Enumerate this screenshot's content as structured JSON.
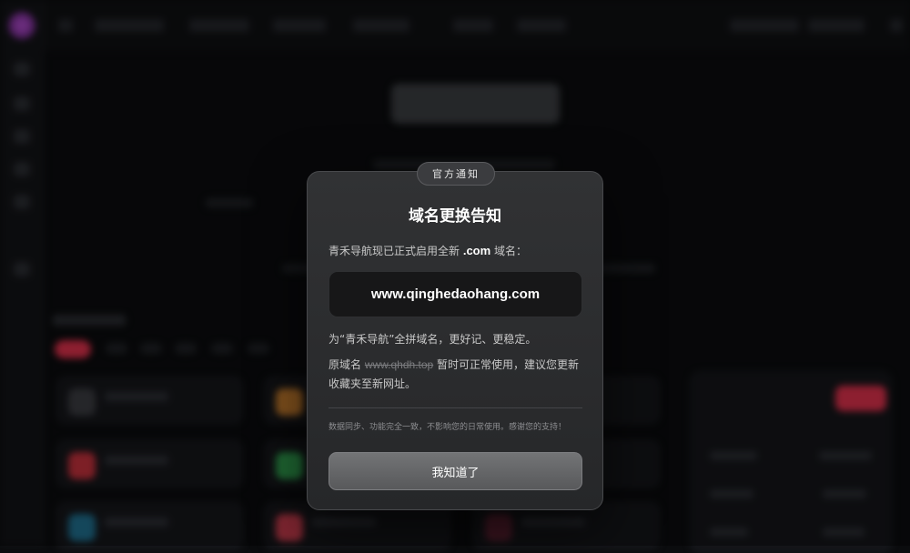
{
  "notice": {
    "badge": "官方通知",
    "title": "域名更换告知",
    "intro_before": "青禾导航现已正式启用全新 ",
    "intro_tld": ".com",
    "intro_after": " 域名：",
    "new_domain": "www.qinghedaohang.com",
    "reason": "为“青禾导航”全拼域名，更好记、更稳定。",
    "old_prefix": "原域名 ",
    "old_domain": "www.qhdh.top",
    "old_suffix": " 暂时可正常使用，建议您更新收藏夹至新网址。",
    "footnote": "数据同步、功能完全一致，不影响您的日常使用。感谢您的支持！",
    "confirm_label": "我知道了"
  },
  "colors": {
    "accent_red": "#d9304a",
    "logo_purple": "#b84fd6",
    "modal_bg": "#2c2d2f"
  }
}
